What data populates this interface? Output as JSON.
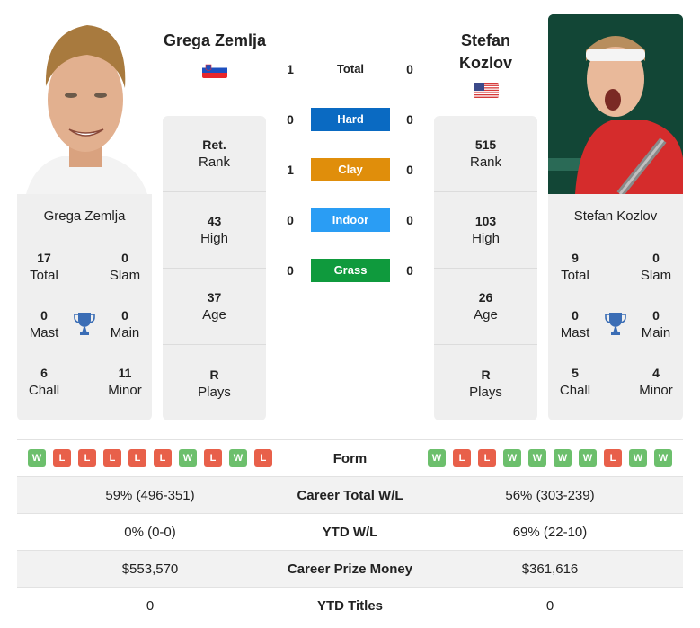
{
  "colors": {
    "hard": "#0a6ac2",
    "clay": "#e08e0b",
    "indoor": "#2a9df4",
    "grass": "#0f9a3d",
    "win": "#6cbf6c",
    "loss": "#e8604a",
    "trophy": "#3a6db5",
    "card_bg": "#efefef"
  },
  "player_left": {
    "name": "Grega Zemlja",
    "country": "Slovenia",
    "flag_icon": "flag-slovenia",
    "info": [
      {
        "value": "Ret.",
        "label": "Rank"
      },
      {
        "value": "43",
        "label": "High"
      },
      {
        "value": "37",
        "label": "Age"
      },
      {
        "value": "R",
        "label": "Plays"
      }
    ],
    "titles": {
      "total": {
        "value": "17",
        "label": "Total"
      },
      "slam": {
        "value": "0",
        "label": "Slam"
      },
      "mast": {
        "value": "0",
        "label": "Mast"
      },
      "main": {
        "value": "0",
        "label": "Main"
      },
      "chall": {
        "value": "6",
        "label": "Chall"
      },
      "minor": {
        "value": "11",
        "label": "Minor"
      }
    },
    "form": [
      "W",
      "L",
      "L",
      "L",
      "L",
      "L",
      "W",
      "L",
      "W",
      "L"
    ]
  },
  "player_right": {
    "name": "Stefan Kozlov",
    "country": "USA",
    "flag_icon": "flag-usa",
    "info": [
      {
        "value": "515",
        "label": "Rank"
      },
      {
        "value": "103",
        "label": "High"
      },
      {
        "value": "26",
        "label": "Age"
      },
      {
        "value": "R",
        "label": "Plays"
      }
    ],
    "titles": {
      "total": {
        "value": "9",
        "label": "Total"
      },
      "slam": {
        "value": "0",
        "label": "Slam"
      },
      "mast": {
        "value": "0",
        "label": "Mast"
      },
      "main": {
        "value": "0",
        "label": "Main"
      },
      "chall": {
        "value": "5",
        "label": "Chall"
      },
      "minor": {
        "value": "4",
        "label": "Minor"
      }
    },
    "form": [
      "W",
      "L",
      "L",
      "W",
      "W",
      "W",
      "W",
      "L",
      "W",
      "W"
    ]
  },
  "h2h": [
    {
      "label": "Total",
      "left": "1",
      "right": "0"
    },
    {
      "label": "Hard",
      "left": "0",
      "right": "0"
    },
    {
      "label": "Clay",
      "left": "1",
      "right": "0"
    },
    {
      "label": "Indoor",
      "left": "0",
      "right": "0"
    },
    {
      "label": "Grass",
      "left": "0",
      "right": "0"
    }
  ],
  "comparison": [
    {
      "label": "Form",
      "left": "",
      "right": ""
    },
    {
      "label": "Career Total W/L",
      "left": "59% (496-351)",
      "right": "56% (303-239)"
    },
    {
      "label": "YTD W/L",
      "left": "0% (0-0)",
      "right": "69% (22-10)"
    },
    {
      "label": "Career Prize Money",
      "left": "$553,570",
      "right": "$361,616"
    },
    {
      "label": "YTD Titles",
      "left": "0",
      "right": "0"
    }
  ]
}
